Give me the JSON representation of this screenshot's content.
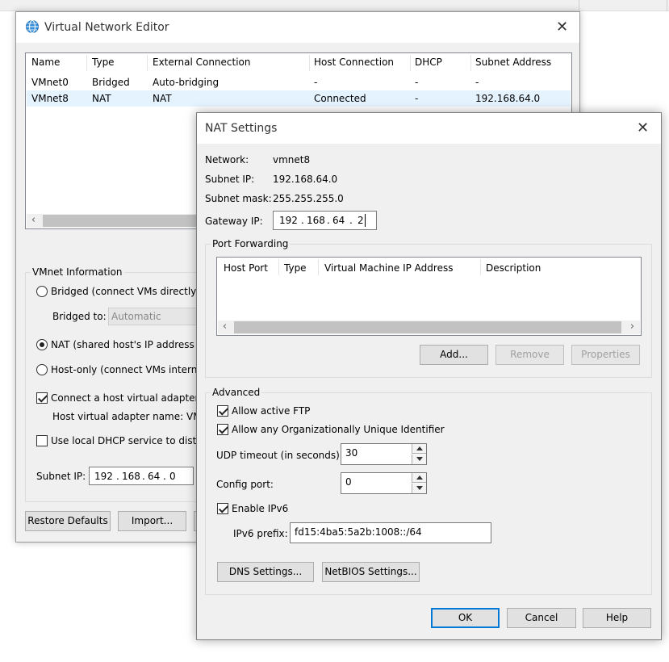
{
  "main_window": {
    "title": "Virtual Network Editor",
    "icon": "globe-network-icon",
    "columns": [
      "Name",
      "Type",
      "External Connection",
      "Host Connection",
      "DHCP",
      "Subnet Address"
    ],
    "rows": [
      [
        "VMnet0",
        "Bridged",
        "Auto-bridging",
        "-",
        "-",
        "-"
      ],
      [
        "VMnet8",
        "NAT",
        "NAT",
        "Connected",
        "-",
        "192.168.64.0"
      ]
    ],
    "selected_row": "VMnet8",
    "vmnet_info": {
      "group_label": "VMnet Information",
      "bridged_label": "Bridged (connect VMs directly to",
      "bridged_to_label": "Bridged to:",
      "bridged_to_value": "Automatic",
      "nat_label": "NAT (shared host's IP address w",
      "hostonly_label": "Host-only (connect VMs internal",
      "selected_mode": "NAT",
      "connect_adapter_label": "Connect a host virtual adapter t",
      "connect_adapter_checked": true,
      "adapter_name_label": "Host virtual adapter name: VMv",
      "dhcp_label": "Use local DHCP service to distrib",
      "dhcp_checked": false,
      "subnet_ip_label": "Subnet IP:",
      "subnet_ip_octets": [
        "192",
        "168",
        "64",
        "0"
      ]
    },
    "buttons": {
      "restore_defaults": "Restore Defaults",
      "import": "Import..."
    }
  },
  "nat_dialog": {
    "title": "NAT Settings",
    "network_label": "Network:",
    "network_value": "vmnet8",
    "subnet_ip_label": "Subnet IP:",
    "subnet_ip_value": "192.168.64.0",
    "subnet_mask_label": "Subnet mask:",
    "subnet_mask_value": "255.255.255.0",
    "gateway_label": "Gateway IP:",
    "gateway_octets": [
      "192",
      "168",
      "64",
      "2"
    ],
    "port_forwarding": {
      "group_label": "Port Forwarding",
      "columns": [
        "Host Port",
        "Type",
        "Virtual Machine IP Address",
        "Description"
      ],
      "add_button": "Add...",
      "remove_button": "Remove",
      "properties_button": "Properties"
    },
    "advanced": {
      "group_label": "Advanced",
      "allow_ftp_label": "Allow active FTP",
      "allow_ftp_checked": true,
      "allow_oui_label": "Allow any Organizationally Unique Identifier",
      "allow_oui_checked": true,
      "udp_timeout_label": "UDP timeout (in seconds):",
      "udp_timeout_value": "30",
      "config_port_label": "Config port:",
      "config_port_value": "0",
      "enable_ipv6_label": "Enable IPv6",
      "enable_ipv6_checked": true,
      "ipv6_prefix_label": "IPv6 prefix:",
      "ipv6_prefix_value": "fd15:4ba5:5a2b:1008::/64",
      "dns_button": "DNS Settings...",
      "netbios_button": "NetBIOS Settings..."
    },
    "ok_button": "OK",
    "cancel_button": "Cancel",
    "help_button": "Help"
  }
}
